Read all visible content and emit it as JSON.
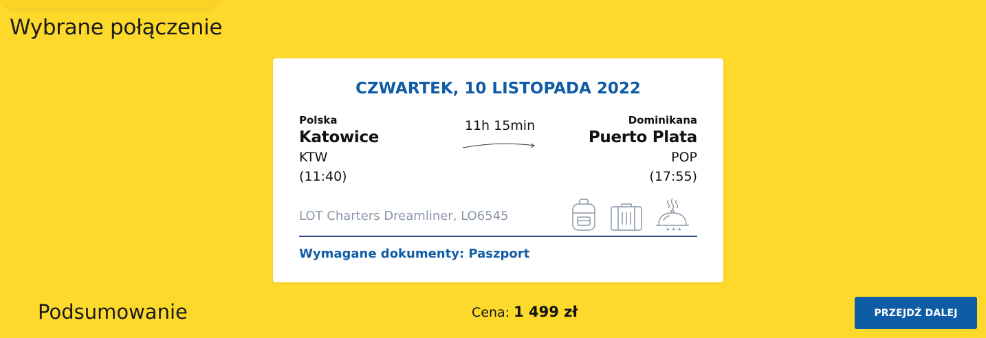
{
  "header": {
    "title": "Wybrane połączenie"
  },
  "flight": {
    "date": "CZWARTEK, 10 LISTOPADA 2022",
    "origin": {
      "country": "Polska",
      "city": "Katowice",
      "code": "KTW",
      "time": "(11:40)"
    },
    "destination": {
      "country": "Dominikana",
      "city": "Puerto Plata",
      "code": "POP",
      "time": "(17:55)"
    },
    "duration": "11h 15min",
    "airline": "LOT Charters Dreamliner, LO6545",
    "amenities": [
      "backpack-icon",
      "suitcase-icon",
      "meal-icon"
    ],
    "documents": "Wymagane dokumenty: Paszport"
  },
  "summary": {
    "title": "Podsumowanie",
    "price_label": "Cena:",
    "price_value": "1 499 zł",
    "next_button": "PRZEJDŹ DALEJ"
  },
  "colors": {
    "background": "#FDD92C",
    "accent": "#0F5CA6",
    "muted": "#8A97A6"
  }
}
